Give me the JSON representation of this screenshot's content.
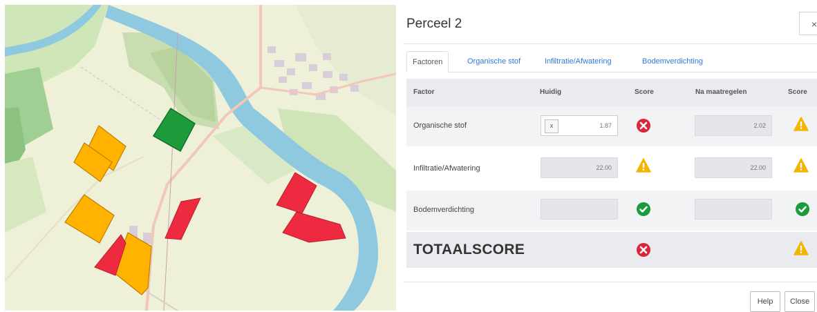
{
  "modal": {
    "title": "Perceel 2",
    "close_glyph": "×",
    "tabs": [
      {
        "label": "Factoren",
        "active": true
      },
      {
        "label": "Organische stof",
        "active": false
      },
      {
        "label": "Infiltratie/Afwatering",
        "active": false
      },
      {
        "label": "Bodemverdichting",
        "active": false
      }
    ],
    "table": {
      "headers": {
        "factor": "Factor",
        "huidig": "Huidig",
        "score": "Score",
        "na": "Na maatregelen",
        "score2": "Score"
      },
      "rows": [
        {
          "factor": "Organische stof",
          "huidig": "1.87",
          "huidig_clear": "x",
          "score_icon": "error-icon",
          "na": "2.02",
          "na_score_icon": "warning-icon"
        },
        {
          "factor": "Infiltratie/Afwatering",
          "huidig": "22.00",
          "score_icon": "warning-icon",
          "na": "22.00",
          "na_score_icon": "warning-icon"
        },
        {
          "factor": "Bodemverdichting",
          "huidig": "",
          "score_icon": "ok-icon",
          "na": "",
          "na_score_icon": "ok-icon"
        }
      ],
      "total": {
        "label": "TOTAALSCORE",
        "score_icon": "error-icon",
        "na_score_icon": "warning-icon"
      }
    },
    "footer": {
      "help": "Help",
      "close": "Close"
    }
  },
  "colors": {
    "parcel_selected": "#1e9a3b",
    "parcel_warning": "#ffb300",
    "parcel_error": "#ee2a40",
    "river": "#8ec9e0",
    "tab_link": "#2a7bd6",
    "icon_error": "#d9263a",
    "icon_warning": "#f5b400",
    "icon_ok": "#1a9b3c"
  }
}
